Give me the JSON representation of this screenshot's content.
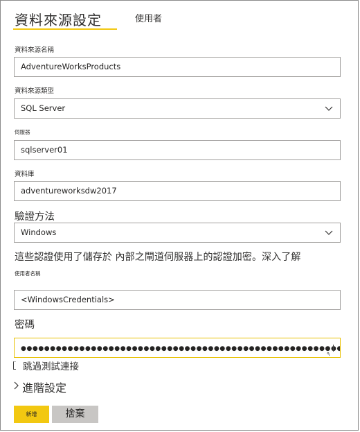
{
  "tabs": {
    "active_label": "資料來源設定",
    "inactive_label": "使用者"
  },
  "fields": {
    "name_label": "資料來源名稱",
    "name_value": "AdventureWorksProducts",
    "type_label": "資料來源類型",
    "type_value": "SQL Server",
    "server_label": "伺服器",
    "server_value": "sqlserver01",
    "database_label": "資料庫",
    "database_value": "adventureworksdw2017",
    "auth_label": "驗證方法",
    "auth_value": "Windows",
    "note": "這些認證使用了儲存於 內部之閘道伺服器上的認證加密。深入了解",
    "username_label": "使用者名稱",
    "username_value": "<WindowsCredentials>",
    "password_label": "密碼",
    "password_value": "●●●●●●●●●●●●●●●●●●●●●●●●●●●●●●●●●●●●●●●●●●●●●●●●●●●●●●●●●●●●●"
  },
  "skip_test": {
    "label": "跳過測試連接"
  },
  "advanced": {
    "label": "進階設定"
  },
  "buttons": {
    "add_label": "新增",
    "discard_label": "捨棄"
  },
  "colors": {
    "accent": "#f2c811",
    "border": "#a19f9d",
    "secondary_button": "#c8c6c4"
  }
}
